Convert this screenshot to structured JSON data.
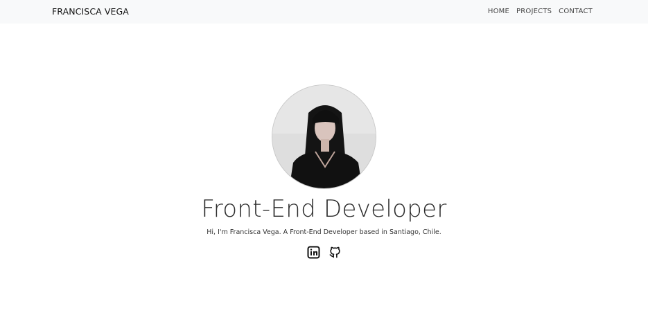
{
  "nav": {
    "brand": "FRANCISCA VEGA",
    "links": [
      "HOME",
      "PROJECTS",
      "CONTACT"
    ]
  },
  "hero": {
    "title": "Front-End Developer",
    "subtitle": "Hi, I'm Francisca Vega. A Front-End Developer based in Santiago, Chile."
  },
  "social": {
    "icons": [
      "linkedin-icon",
      "github-icon"
    ]
  },
  "colors": {
    "navbar_bg": "#f8f9fa",
    "text": "#212529",
    "page_bg": "#ffffff"
  }
}
